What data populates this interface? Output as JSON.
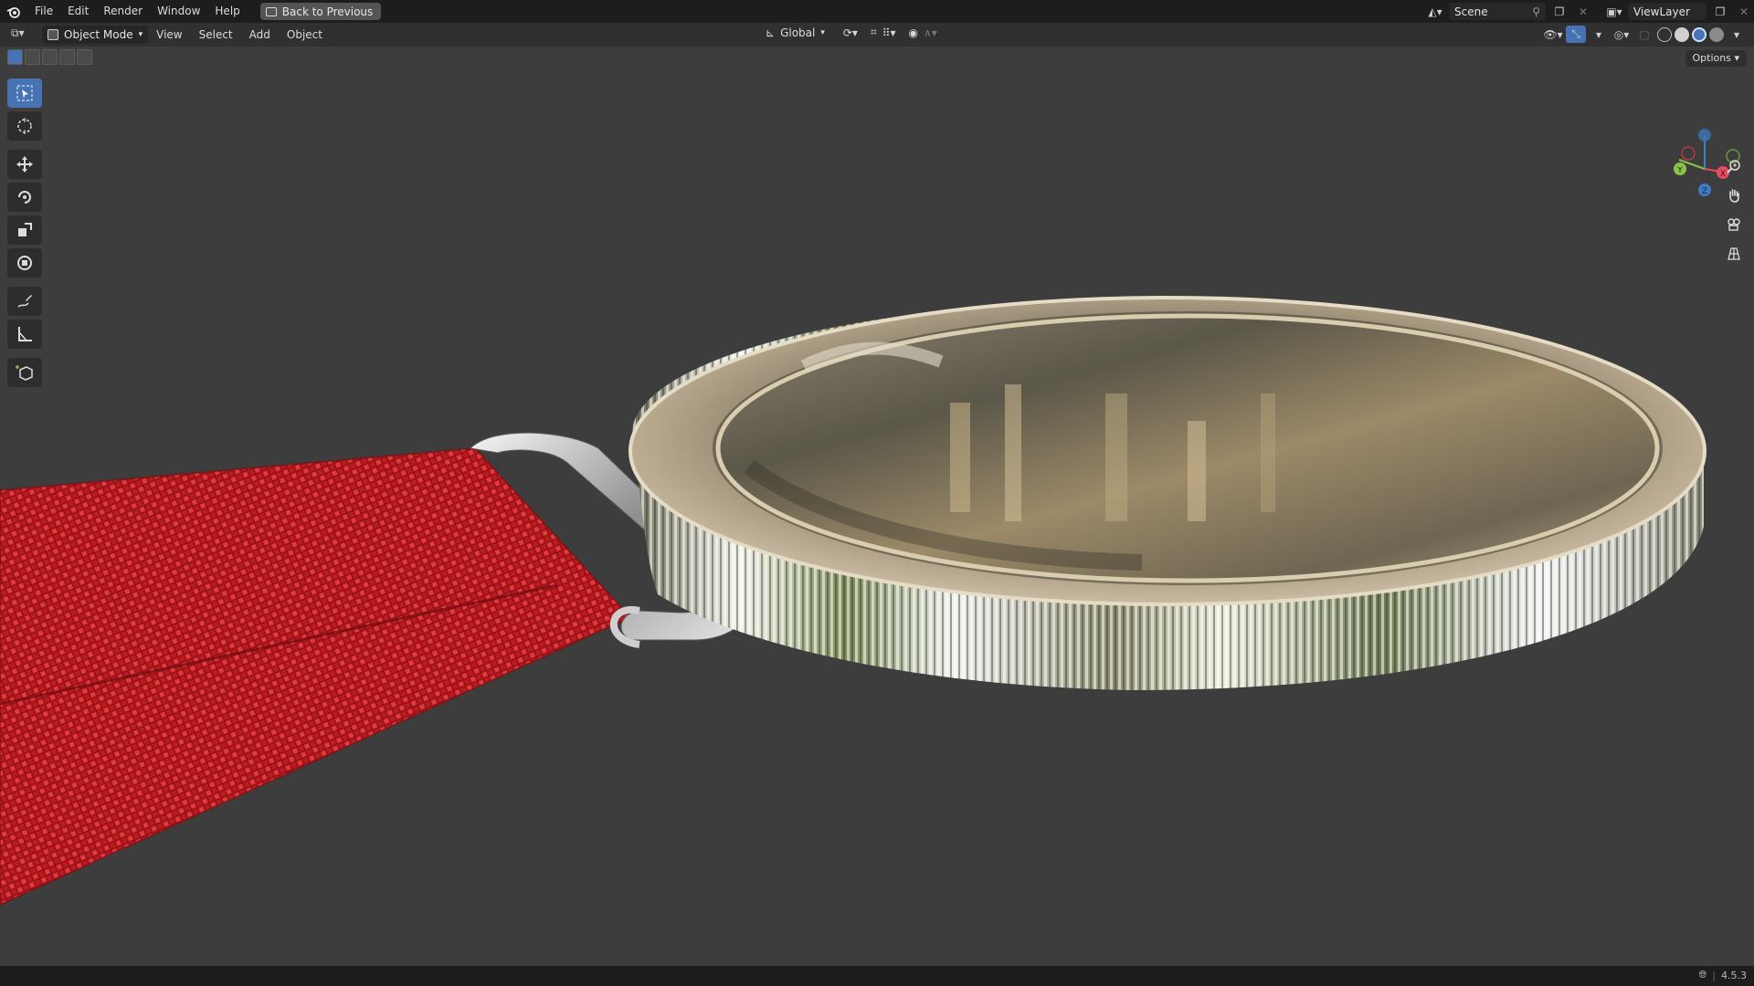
{
  "menubar": {
    "items": [
      "File",
      "Edit",
      "Render",
      "Window",
      "Help"
    ],
    "back_button": "Back to Previous",
    "scene_label": "Scene",
    "view_layer_label": "ViewLayer"
  },
  "viewport_header": {
    "mode": "Object Mode",
    "menus": [
      "View",
      "Select",
      "Add",
      "Object"
    ],
    "transform_orientation": "Global",
    "options_label": "Options"
  },
  "toolbar": {
    "tools": [
      "select-box-icon",
      "cursor-icon",
      "move-icon",
      "rotate-icon",
      "scale-icon",
      "transform-icon",
      "annotate-icon",
      "measure-icon",
      "add-cube-icon"
    ],
    "active_tool": "select-box-icon"
  },
  "gizmo": {
    "axes": [
      "X",
      "Y",
      "Z"
    ],
    "colors": {
      "x": "#e84a5f",
      "y": "#8bc34a",
      "z": "#3d7cc9"
    }
  },
  "status": {
    "version": "4.5.3"
  },
  "colors": {
    "accent": "#4772b3",
    "ribbon": "#c0202a",
    "viewport_bg": "#3d3d3d"
  }
}
